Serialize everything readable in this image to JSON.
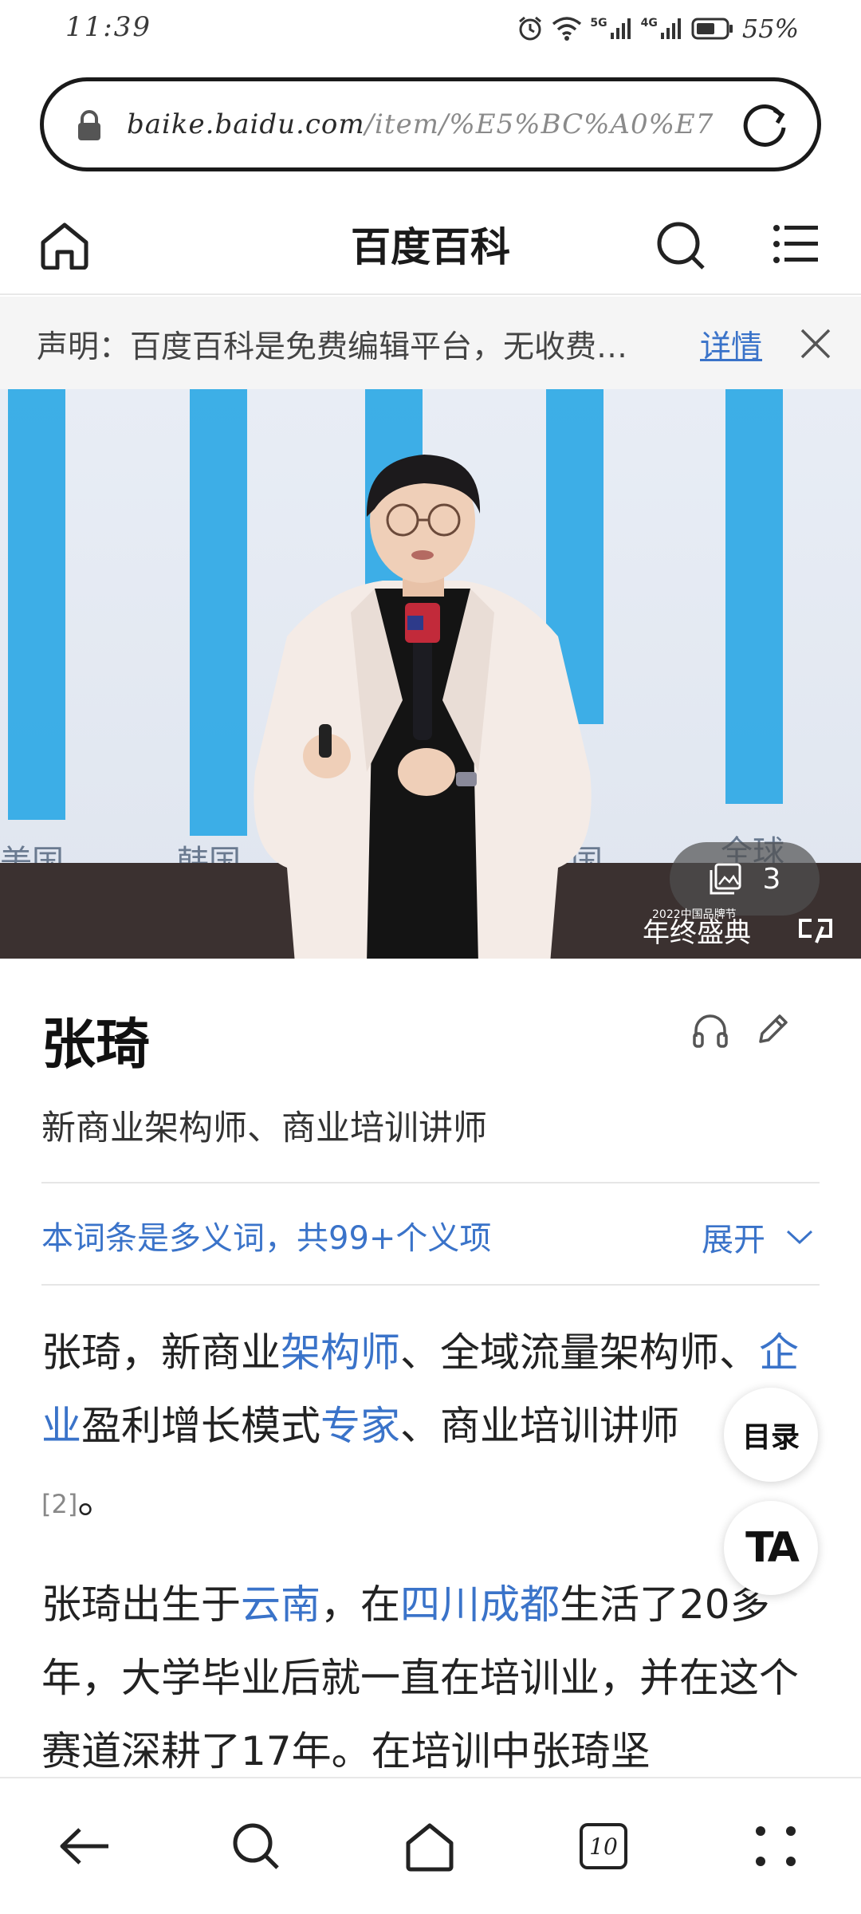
{
  "status_bar": {
    "time": "11:39",
    "battery": "55%",
    "net_5g": "5G",
    "net_4g": "4G"
  },
  "url_bar": {
    "host": "baike.baidu.com",
    "path": "/item/%E5%BC%A0%E7"
  },
  "header": {
    "title": "百度百科"
  },
  "notice": {
    "text": "声明：百度百科是免费编辑平台，无收费…",
    "link": "详情"
  },
  "hero": {
    "axis_labels": [
      "美国",
      "韩国",
      "德国",
      "全球"
    ],
    "photo_count": "3",
    "watermark": "年终盛典",
    "watermark_small": "2022中国品牌节"
  },
  "article": {
    "title": "张琦",
    "subtitle": "新商业架构师、商业培训讲师",
    "polysemy": "本词条是多义词，共99+个义项",
    "expand": "展开",
    "para1": {
      "t1": "张琦，新商业",
      "link1": "架构师",
      "t2": "、全域流量架构师、",
      "link2": "企业",
      "t3": "盈利增长模式",
      "link3": "专家",
      "t4": "、商业培训讲师",
      "cite": "[2]",
      "end": "。"
    },
    "para2": {
      "t1": "张琦出生于",
      "link1": "云南",
      "t2": "，在",
      "link2": "四川成都",
      "t3": "生活了20多年，大学毕业后就一直在培训业，并在这个赛道深耕了17年。在培训中张琦坚"
    }
  },
  "floating": {
    "toc": "目录",
    "ta": "TA"
  },
  "bottom_nav": {
    "tabs_count": "10"
  },
  "colors": {
    "link": "#3a73c9",
    "accent_bar": "#2aa7e6"
  }
}
